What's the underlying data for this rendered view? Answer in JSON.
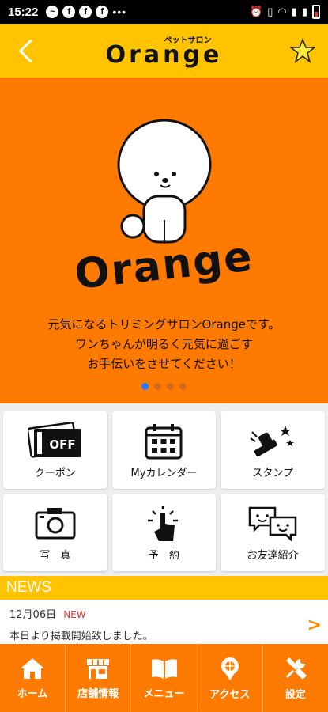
{
  "status_bar": {
    "time": "15:22",
    "notif_icons": [
      "messenger-icon",
      "facebook-icon",
      "facebook-icon",
      "facebook-icon"
    ],
    "more": "•••"
  },
  "header": {
    "subtitle": "ペットサロン",
    "title": "Orange"
  },
  "hero": {
    "logo": "Orange",
    "text_lines": [
      "元気になるトリミングサロンOrangeです。",
      "ワンちゃんが明るく元気に過ごす",
      "お手伝いをさせてください！"
    ],
    "dot_count": 4,
    "active_dot": 0
  },
  "menu": [
    {
      "label": "クーポン",
      "icon": "coupon-icon",
      "badge": "OFF"
    },
    {
      "label": "Myカレンダー",
      "icon": "calendar-icon"
    },
    {
      "label": "スタンプ",
      "icon": "stamp-icon"
    },
    {
      "label": "写　真",
      "icon": "camera-icon"
    },
    {
      "label": "予　約",
      "icon": "reserve-tap-icon"
    },
    {
      "label": "お友達紹介",
      "icon": "friend-chat-icon"
    }
  ],
  "news": {
    "heading": "NEWS",
    "items": [
      {
        "date": "12月06日",
        "badge": "NEW",
        "text": "本日より掲載開始致しました。"
      }
    ]
  },
  "bottom_nav": [
    {
      "label": "ホーム",
      "icon": "home-icon"
    },
    {
      "label": "店舗情報",
      "icon": "store-icon"
    },
    {
      "label": "メニュー",
      "icon": "book-icon"
    },
    {
      "label": "アクセス",
      "icon": "map-pin-icon"
    },
    {
      "label": "設定",
      "icon": "tools-icon"
    }
  ],
  "colors": {
    "header": "#ffc300",
    "hero": "#ff7a00",
    "nav": "#ff7a00",
    "news_new": "#e53935"
  }
}
